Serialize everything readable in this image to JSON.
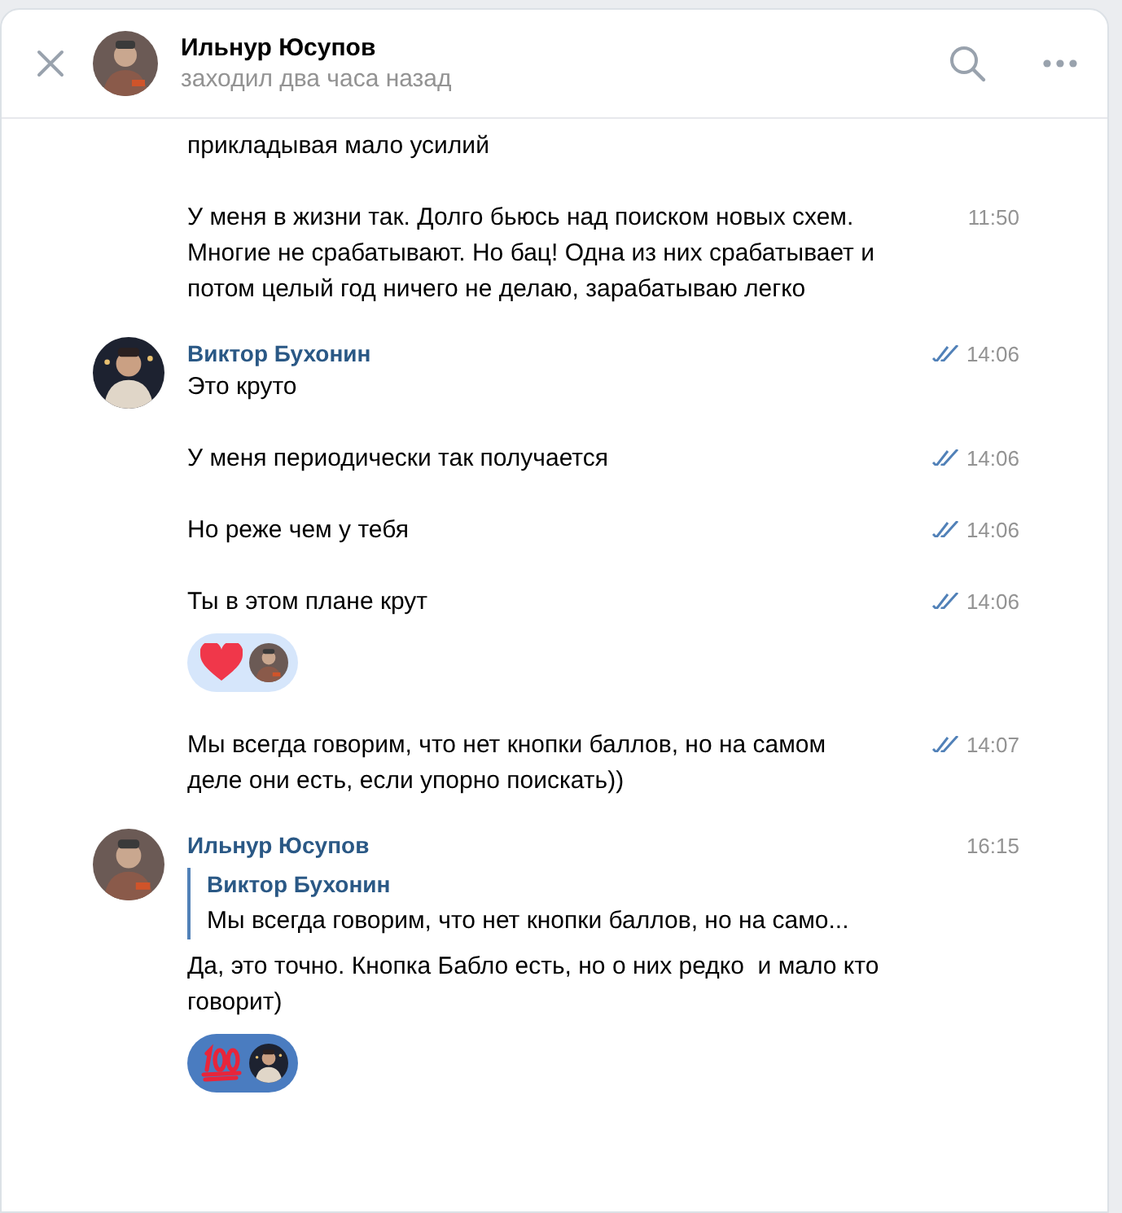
{
  "header": {
    "name": "Ильнур Юсупов",
    "status": "заходил два часа назад"
  },
  "groups": [
    {
      "messages": [
        {
          "text": "прикладывая мало усилий"
        },
        {
          "text": "У меня в жизни так. Долго бьюсь над поиском новых схем. Многие не срабатывают. Но бац! Одна из них срабатывает и потом целый год ничего не делаю, зарабатываю легко",
          "time": "11:50",
          "read": false
        }
      ]
    },
    {
      "author": "Виктор Бухонин",
      "messages": [
        {
          "text": "Это круто",
          "time": "14:06",
          "read": true
        },
        {
          "text": "У меня периодически так получается",
          "time": "14:06",
          "read": true
        },
        {
          "text": "Но реже чем у тебя",
          "time": "14:06",
          "read": true
        },
        {
          "text": "Ты в этом плане крут",
          "time": "14:06",
          "read": true,
          "reactions": [
            {
              "kind": "heart",
              "selected": false
            }
          ]
        },
        {
          "text": "Мы всегда говорим, что нет кнопки баллов, но на самом деле они есть, если упорно поискать))",
          "time": "14:07",
          "read": true
        }
      ]
    },
    {
      "author": "Ильнур Юсупов",
      "messages": [
        {
          "text": "Да, это точно. Кнопка Бабло есть, но о них редко  и мало кто говорит)",
          "time": "16:15",
          "read": false,
          "reply": {
            "author": "Виктор Бухонин",
            "text": "Мы всегда говорим, что нет кнопки баллов, но на само..."
          },
          "reactions": [
            {
              "kind": "hundred",
              "selected": true
            }
          ]
        }
      ]
    }
  ]
}
